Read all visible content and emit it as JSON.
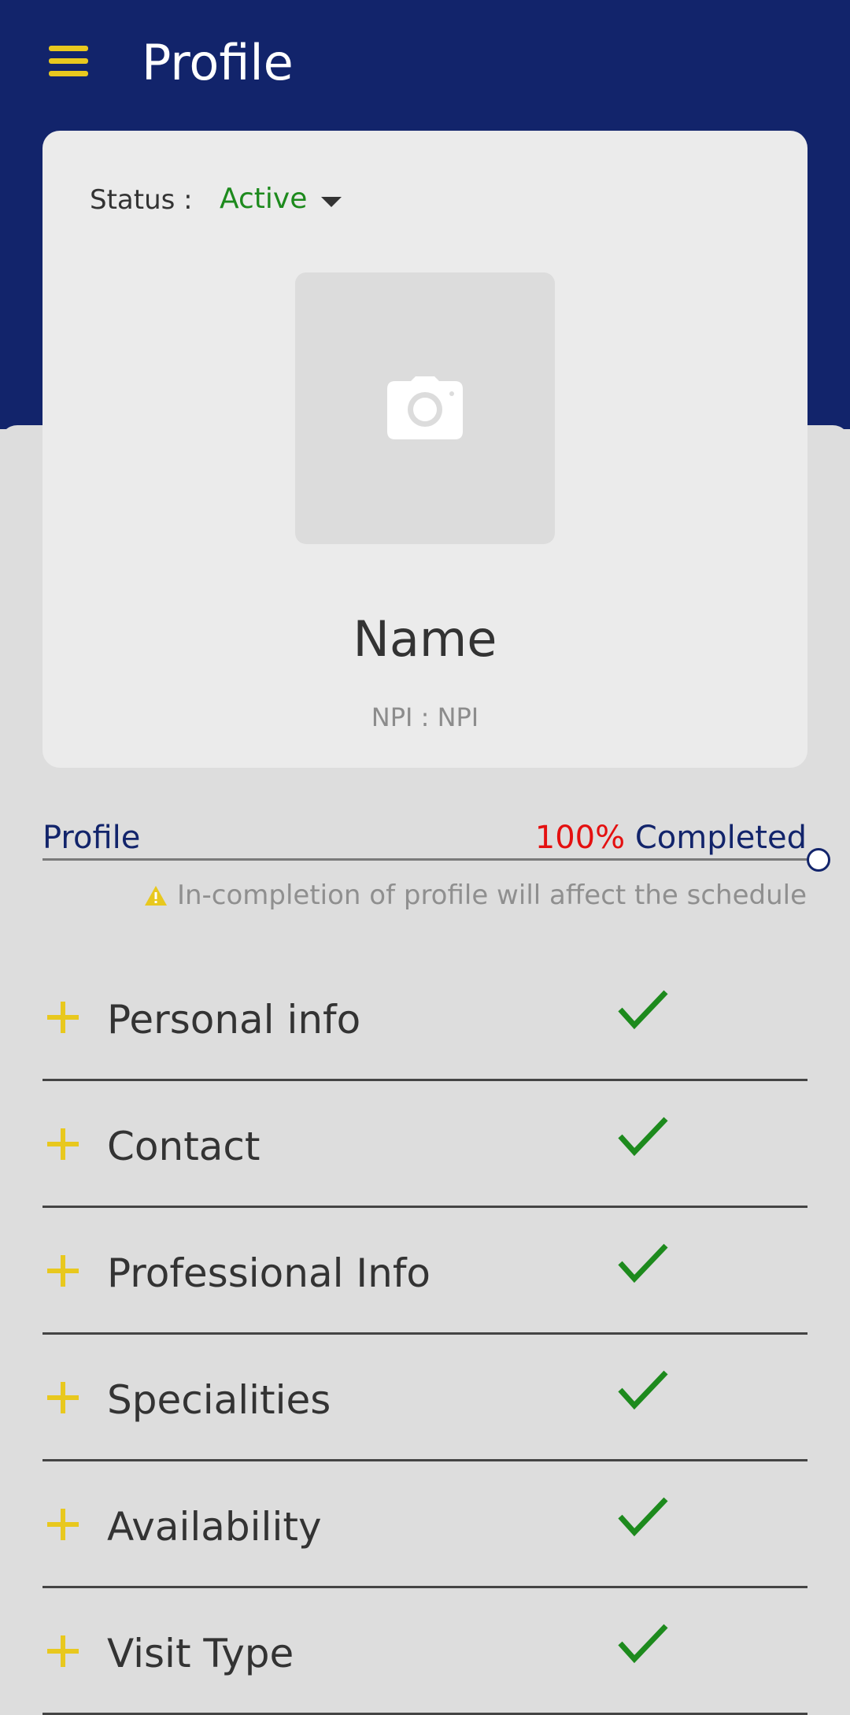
{
  "header": {
    "title": "Profile",
    "menu_icon": "hamburger-menu-icon",
    "background": "#12246b",
    "accent": "#e8c81e"
  },
  "profile_card": {
    "status_label": "Status :",
    "status_value": "Active",
    "status_color": "#1d8a1d",
    "photo_icon": "camera-icon",
    "name": "Name",
    "npi": "NPI : NPI"
  },
  "progress": {
    "label": "Profile",
    "percent_text": "100%",
    "completed_text": "Completed",
    "value": 1.0,
    "warning_icon": "warning-icon",
    "warning": "In-completion of profile will affect the schedule"
  },
  "sections": [
    {
      "label": "Personal info",
      "expand_icon": "plus-icon",
      "status_icon": "check-icon"
    },
    {
      "label": "Contact",
      "expand_icon": "plus-icon",
      "status_icon": "check-icon"
    },
    {
      "label": "Professional Info",
      "expand_icon": "plus-icon",
      "status_icon": "check-icon"
    },
    {
      "label": "Specialities",
      "expand_icon": "plus-icon",
      "status_icon": "check-icon"
    },
    {
      "label": "Availability",
      "expand_icon": "plus-icon",
      "status_icon": "check-icon"
    },
    {
      "label": "Visit Type",
      "expand_icon": "plus-icon",
      "status_icon": "check-icon"
    }
  ]
}
